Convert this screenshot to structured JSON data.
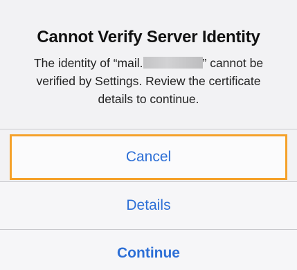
{
  "alert": {
    "title": "Cannot Verify Server Identity",
    "message_prefix": "The identity of “mail.",
    "message_suffix": "” cannot be verified by Settings. Review the certificate details to continue.",
    "actions": [
      {
        "label": "Cancel"
      },
      {
        "label": "Details"
      },
      {
        "label": "Continue"
      }
    ]
  },
  "colors": {
    "action_text": "#2d6fd6",
    "focus_ring": "#f5a12a"
  }
}
